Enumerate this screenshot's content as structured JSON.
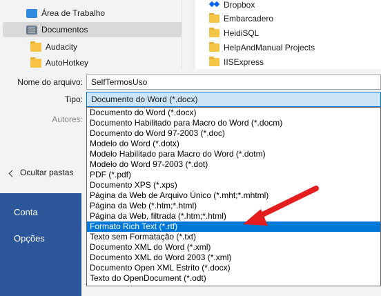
{
  "backstage": {
    "items": [
      {
        "label": "Conta"
      },
      {
        "label": "Opções"
      }
    ]
  },
  "nav_pane": {
    "items": [
      {
        "label": "Área de Trabalho",
        "icon": "desktop-icon",
        "selected": false
      },
      {
        "label": "Documentos",
        "icon": "documents-icon",
        "selected": true
      },
      {
        "label": "Audacity",
        "icon": "folder-icon",
        "selected": false
      },
      {
        "label": "AutoHotkey",
        "icon": "folder-icon",
        "selected": false
      }
    ]
  },
  "file_pane": {
    "items": [
      {
        "label": "Dropbox",
        "icon": "dropbox-icon"
      },
      {
        "label": "Embarcadero",
        "icon": "folder-icon"
      },
      {
        "label": "HeidiSQL",
        "icon": "folder-icon"
      },
      {
        "label": "HelpAndManual Projects",
        "icon": "folder-icon"
      },
      {
        "label": "IISExpress",
        "icon": "folder-icon"
      }
    ]
  },
  "form": {
    "filename_label": "Nome do arquivo:",
    "filename_value": "SelfTermosUso",
    "type_label": "Tipo:",
    "type_selected": "Documento do Word (*.docx)",
    "authors_label": "Autores:",
    "hide_folders_label": "Ocultar pastas"
  },
  "dropdown": {
    "highlighted_index": 11,
    "options": [
      "Documento do Word (*.docx)",
      "Documento Habilitado para Macro do Word (*.docm)",
      "Documento do Word 97-2003 (*.doc)",
      "Modelo do Word (*.dotx)",
      "Modelo Habilitado para Macro do Word (*.dotm)",
      "Modelo do Word 97-2003 (*.dot)",
      "PDF (*.pdf)",
      "Documento XPS (*.xps)",
      "Página da Web de Arquivo Único (*.mht;*.mhtml)",
      "Página da Web (*.htm;*.html)",
      "Página da Web, filtrada (*.htm;*.html)",
      "Formato Rich Text (*.rtf)",
      "Texto sem Formatação (*.txt)",
      "Documento XML do Word (*.xml)",
      "Documento XML do Word 2003 (*.xml)",
      "Documento Open XML Estrito (*.docx)",
      "Texto do OpenDocument (*.odt)"
    ]
  },
  "colors": {
    "word_blue": "#2b579a",
    "highlight": "#0078d7",
    "arrow": "#e41e1e"
  }
}
